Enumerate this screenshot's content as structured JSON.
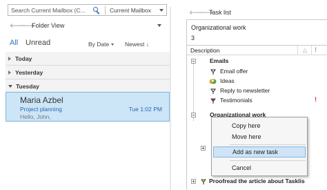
{
  "mailbox": {
    "search_placeholder": "Search Current Mailbox (C...",
    "scope_label": "Current Mailbox",
    "folder_view_label": "Folder View",
    "filters": {
      "all": "All",
      "unread": "Unread"
    },
    "sort_by": "By Date",
    "sort_order": "Newest ↓",
    "groups": [
      "Today",
      "Yesterday",
      "Tuesday"
    ],
    "selected_mail": {
      "sender": "Maria Azbel",
      "subject": "Project planning",
      "time": "Tue 1:02 PM",
      "preview": "Hello, John,"
    }
  },
  "tasklist": {
    "title": "Task list",
    "selected_name": "Organizational work",
    "selected_count": "3",
    "column_description": "Description",
    "column_warn_icon": "warning-triangle-icon",
    "column_priority_icon": "exclamation-icon",
    "groups": [
      {
        "label": "Emails",
        "items": [
          {
            "label": "Email offer",
            "flag": "outline",
            "priority": ""
          },
          {
            "label": "Ideas",
            "flag": "green-people",
            "priority": ""
          },
          {
            "label": "Reply to newsletter",
            "flag": "outline",
            "priority": ""
          },
          {
            "label": "Testimonials",
            "flag": "red",
            "priority": "!"
          }
        ]
      },
      {
        "label": "Organizational work",
        "items": []
      }
    ],
    "bottom_item": "Proofread the article about Tasklis",
    "bottom_flag": "yellow"
  },
  "context_menu": {
    "items": [
      "Copy here",
      "Move here",
      "Add as new task",
      "Cancel"
    ],
    "highlighted": "Add as new task"
  },
  "colors": {
    "accent": "#2a72c4",
    "selection_bg": "#cde6f7",
    "priority_red": "#dd2222"
  }
}
